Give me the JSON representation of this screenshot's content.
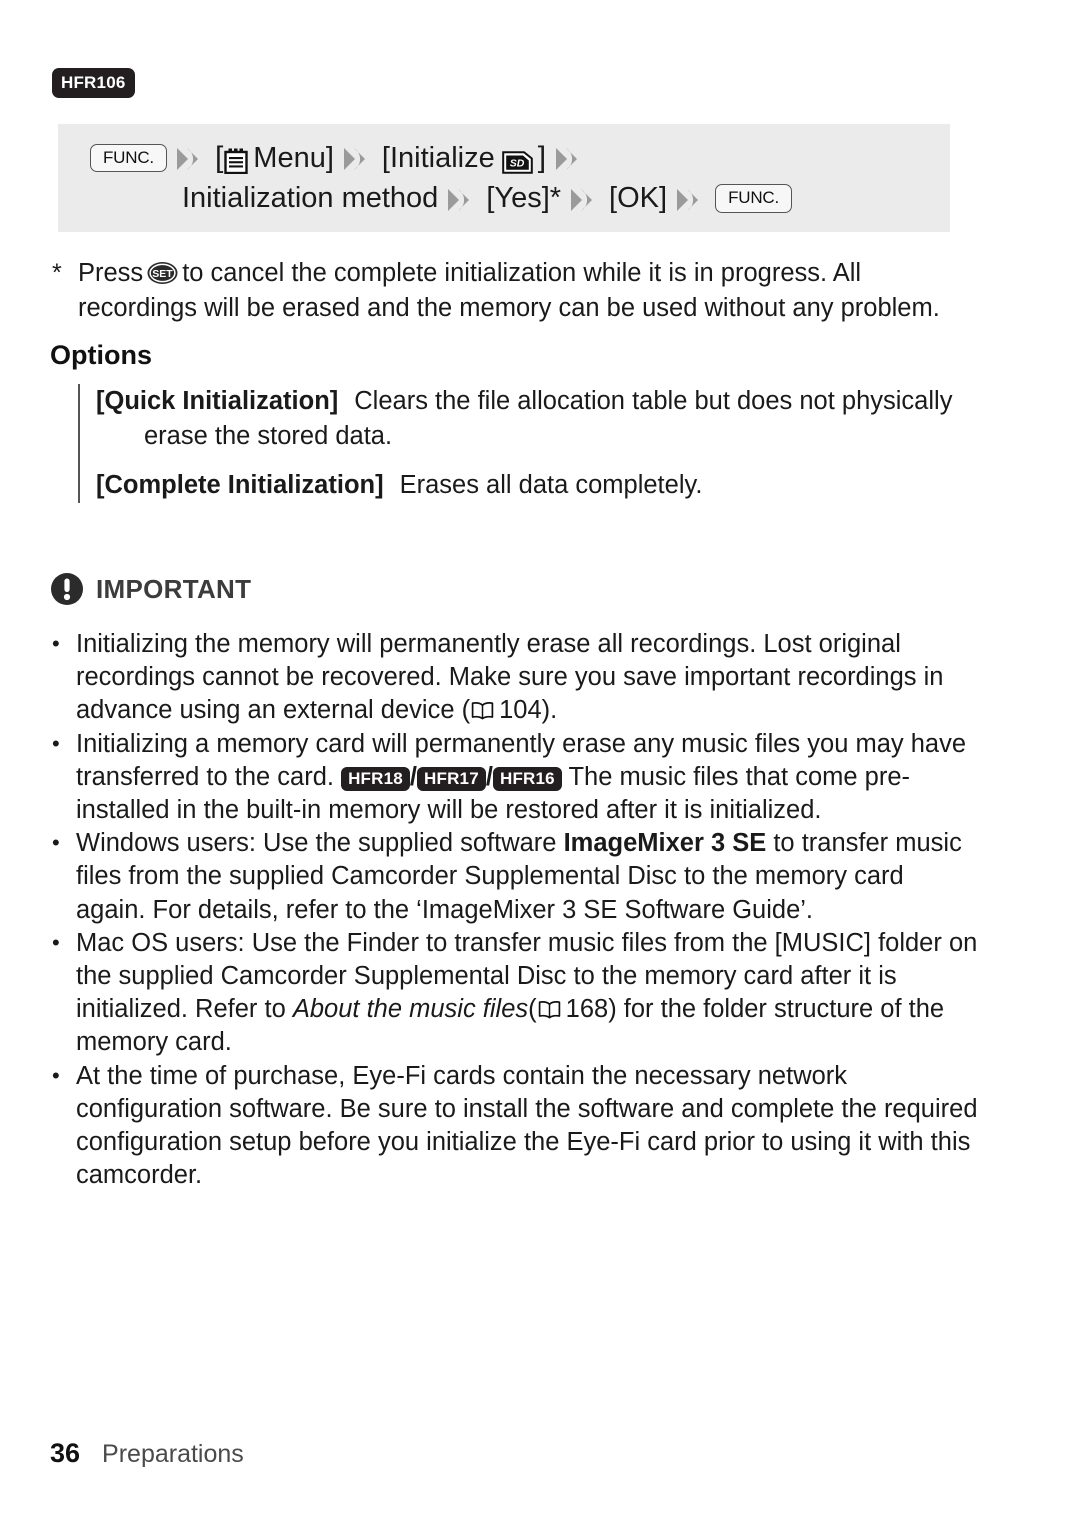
{
  "model_badge": "HFR106",
  "procedure": {
    "line1": {
      "func_key": "FUNC.",
      "menu_open": "[",
      "menu_label": "Menu]",
      "initialize_open": "[Initialize",
      "initialize_close": "]"
    },
    "line2": {
      "method_label": "Initialization method",
      "yes": "[Yes]*",
      "ok": "[OK]",
      "func_key": "FUNC."
    },
    "icons": {
      "arrow": "double-chevron-arrow-icon",
      "menu": "menu-notepad-icon",
      "sd": "sd-card-icon"
    }
  },
  "footnote": {
    "marker": "*",
    "before_icon": "Press",
    "icon": "set-button-icon",
    "icon_label": "SET",
    "after_icon": "to cancel the complete initialization while it is in progress. All recordings will be erased and the memory can be used without any problem."
  },
  "options": {
    "title": "Options",
    "items": [
      {
        "name": "[Quick Initialization]",
        "description": "Clears the file allocation table but does not physically erase the stored data."
      },
      {
        "name": "[Complete Initialization]",
        "description": "Erases all data completely."
      }
    ]
  },
  "important": {
    "icon": "exclamation-circle-icon",
    "label": "IMPORTANT",
    "bullets": [
      {
        "id": "bullet-memory-erase",
        "part1": "Initializing the memory will permanently erase all recordings. Lost original recordings cannot be recovered. Make sure you save important recordings in advance using an external device (",
        "book_icon": "book-page-reference-icon",
        "page_ref": "104",
        "part2": ")."
      },
      {
        "id": "bullet-memory-card-music",
        "part1": "Initializing a memory card will permanently erase any music files you may have transferred to the card.",
        "badges": [
          "HFR18",
          "HFR17",
          "HFR16"
        ],
        "part2": "The music files that come pre-installed in the built-in memory will be restored after it is initialized."
      },
      {
        "id": "bullet-windows-users",
        "part1": "Windows users: Use the supplied software",
        "bold": "ImageMixer 3 SE",
        "part2": "to transfer music files from the supplied Camcorder Supplemental Disc to the memory card again. For details, refer to the ‘ImageMixer 3 SE Software Guide’."
      },
      {
        "id": "bullet-mac-users",
        "part1": "Mac OS users: Use the Finder to transfer music files from the [MUSIC] folder on the supplied Camcorder Supplemental Disc to the memory card after it is initialized. Refer to",
        "italic": "About the music files",
        "part2_open": "(",
        "book_icon": "book-page-reference-icon",
        "page_ref": "168",
        "part2": ") for the folder structure of the memory card."
      },
      {
        "id": "bullet-eyefi-cards",
        "part1": "At the time of purchase, Eye-Fi cards contain the necessary network configuration software. Be sure to install the software and complete the required configuration setup before you initialize the Eye-Fi card prior to using it with this camcorder."
      }
    ]
  },
  "footer": {
    "page_number": "36",
    "section": "Preparations"
  },
  "colors": {
    "badge_bg": "#231f20",
    "proc_box_bg": "#ebebeb",
    "arrow_gray": "#9a9a9a",
    "text": "#1a1a1a"
  }
}
